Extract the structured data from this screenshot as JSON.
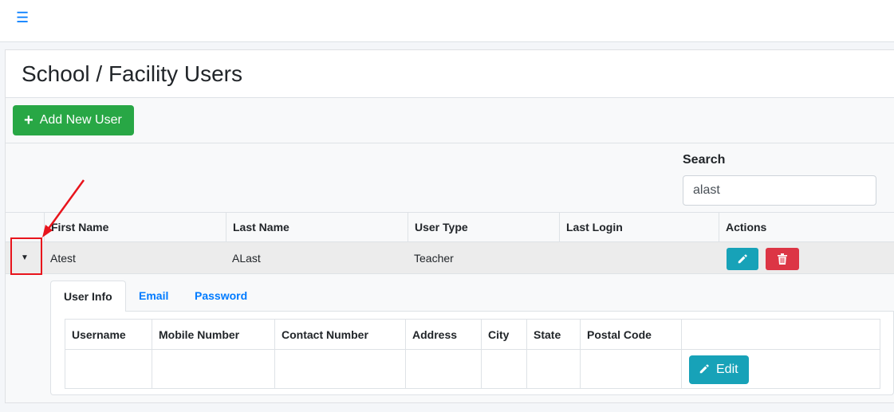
{
  "header": {
    "menu_icon": "hamburger-icon"
  },
  "page": {
    "title": "School / Facility Users"
  },
  "toolbar": {
    "add_user_label": "Add New User",
    "add_icon": "+"
  },
  "search": {
    "label": "Search",
    "value": "alast"
  },
  "users_table": {
    "columns": [
      "First Name",
      "Last Name",
      "User Type",
      "Last Login",
      "Actions"
    ],
    "rows": [
      {
        "first_name": "Atest",
        "last_name": "ALast",
        "user_type": "Teacher",
        "last_login": "",
        "expander": "▼"
      }
    ]
  },
  "detail": {
    "tabs": [
      {
        "label": "User Info",
        "active": true
      },
      {
        "label": "Email",
        "active": false
      },
      {
        "label": "Password",
        "active": false
      }
    ],
    "columns": [
      "Username",
      "Mobile Number",
      "Contact Number",
      "Address",
      "City",
      "State",
      "Postal Code"
    ],
    "edit_label": "Edit"
  },
  "colors": {
    "primary": "#007bff",
    "success": "#28a745",
    "info": "#17a2b8",
    "danger": "#dc3545",
    "annotation": "#e8141c"
  }
}
